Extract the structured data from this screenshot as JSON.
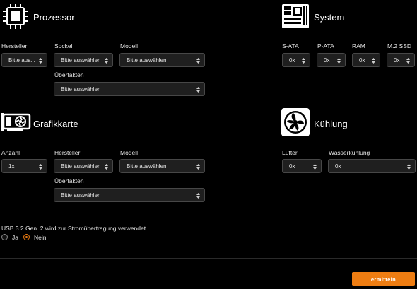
{
  "processor": {
    "title": "Prozessor",
    "hersteller_label": "Hersteller",
    "hersteller_value": "Bitte aus...",
    "sockel_label": "Sockel",
    "sockel_value": "Bitte auswählen",
    "modell_label": "Modell",
    "modell_value": "Bitte auswählen",
    "uebertakten_label": "Übertakten",
    "uebertakten_value": "Bitte auswählen"
  },
  "system": {
    "title": "System",
    "sata_label": "S-ATA",
    "sata_value": "0x",
    "pata_label": "P-ATA",
    "pata_value": "0x",
    "ram_label": "RAM",
    "ram_value": "0x",
    "m2_label": "M.2 SSD",
    "m2_value": "0x"
  },
  "gpu": {
    "title": "Grafikkarte",
    "anzahl_label": "Anzahl",
    "anzahl_value": "1x",
    "hersteller_label": "Hersteller",
    "hersteller_value": "Bitte auswählen",
    "modell_label": "Modell",
    "modell_value": "Bitte auswählen",
    "uebertakten_label": "Übertakten",
    "uebertakten_value": "Bitte auswählen"
  },
  "cooling": {
    "title": "Kühlung",
    "luefter_label": "Lüfter",
    "luefter_value": "0x",
    "wasser_label": "Wasserkühlung",
    "wasser_value": "0x"
  },
  "usb": {
    "question": "USB 3.2 Gen. 2 wird zur Stromübertragung verwendet.",
    "option_yes": "Ja",
    "option_no": "Nein",
    "selected": "Nein"
  },
  "submit_label": "ermitteln",
  "colors": {
    "accent": "#ee7d12",
    "background": "#000000",
    "select_bg": "#1f1f1f"
  }
}
